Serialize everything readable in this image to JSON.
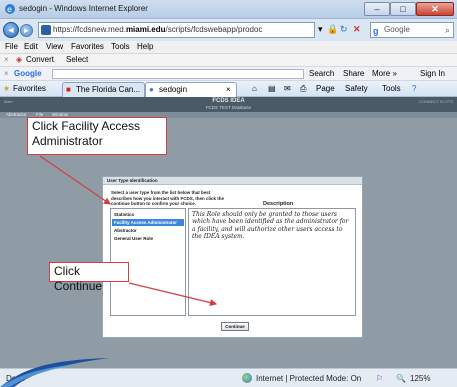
{
  "window": {
    "title": "sedogin - Windows Internet Explorer",
    "minimize": "–",
    "maximize": "□",
    "close": "✕"
  },
  "address": {
    "url_prefix": "https://fcdsnew.med.",
    "url_domain": "miami.edu",
    "url_suffix": "/scripts/fcdswebapp/prodoc",
    "search_placeholder": "Google",
    "search_icon": "search-icon"
  },
  "menu": [
    "File",
    "Edit",
    "View",
    "Favorites",
    "Tools",
    "Help"
  ],
  "convert_toolbar": {
    "convert": "Convert",
    "select": "Select"
  },
  "google_toolbar": {
    "logo": "Google",
    "search": "Search",
    "share": "Share",
    "more": "More »",
    "signin": "Sign In"
  },
  "favorites_bar": {
    "favorites": "Favorites",
    "tab1": "The Florida Can...",
    "tab2": "sedogin",
    "page": "Page",
    "safety": "Safety",
    "tools": "Tools"
  },
  "app": {
    "header_title": "FCDS IDEA",
    "header_subtitle": "FCDS TEST Database",
    "header_left": "Main",
    "header_right": "CONNECT SLOTS",
    "menu": [
      "Abstractor",
      "File",
      "Window"
    ]
  },
  "dialog": {
    "title": "User Type Identification",
    "instructions": "Select a user type from the list below that best describes how you interact with FCDS, then click the continue button to confirm your choice.",
    "description_label": "Description",
    "user_types": [
      "Statistics",
      "Facility Access Administrator",
      "Abstractor",
      "General User Role"
    ],
    "selected_index": 1,
    "description": "This Role should only be granted to those users which have been identified as the administrator for a facility, and will authorize other users access to the IDEA system.",
    "continue_label": "Continue"
  },
  "annotations": {
    "callout1": "Click Facility Access Administrator",
    "callout2": "Click Continue",
    "color": "#d04040"
  },
  "status": {
    "left": "Done",
    "zone": "Internet | Protected Mode: On",
    "zoom": "125%"
  }
}
